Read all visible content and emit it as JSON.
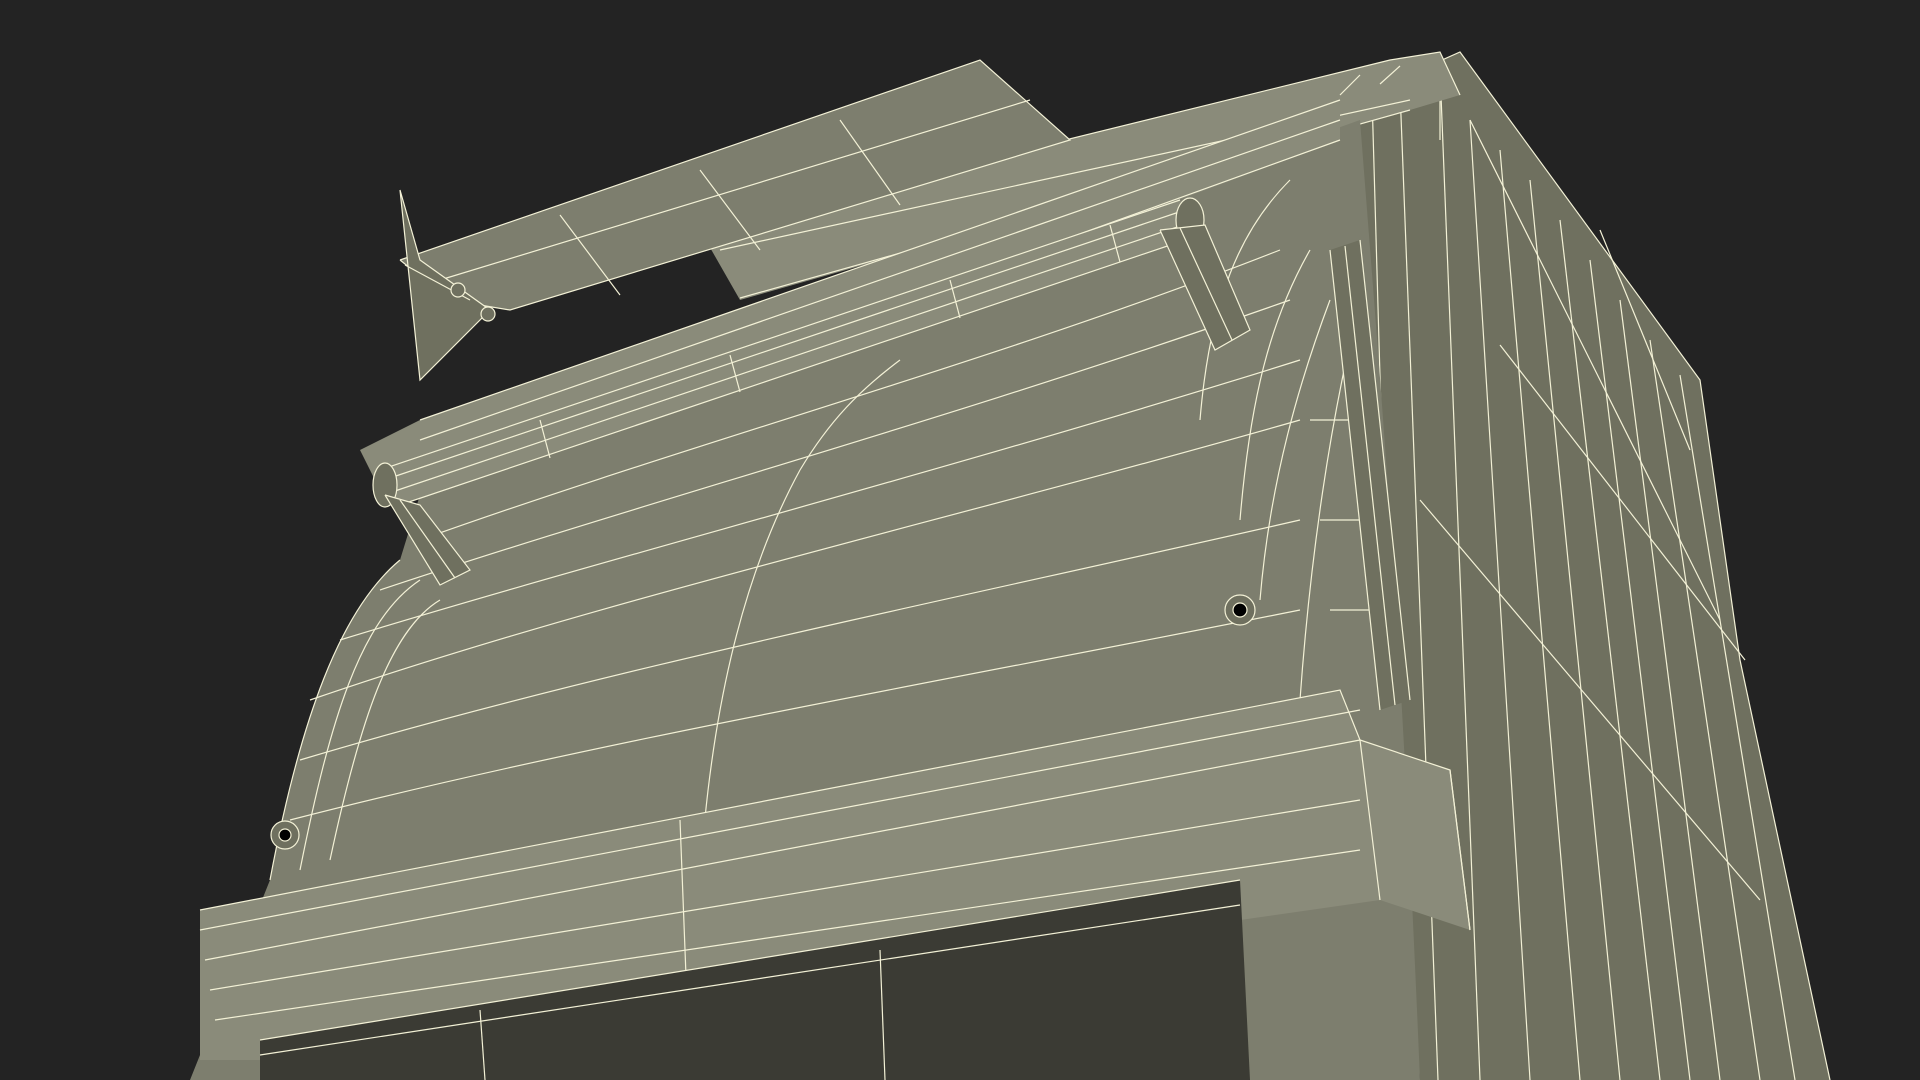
{
  "scene": {
    "subject": "wireframe-render",
    "colors": {
      "background": "#232323",
      "surface": "#7d7e6e",
      "surface_shade": "#6f705f",
      "surface_dark": "#5f6052",
      "surface_light": "#8a8b7a",
      "wire": "#f3f1d6",
      "shadow": "#2c2c26"
    }
  }
}
